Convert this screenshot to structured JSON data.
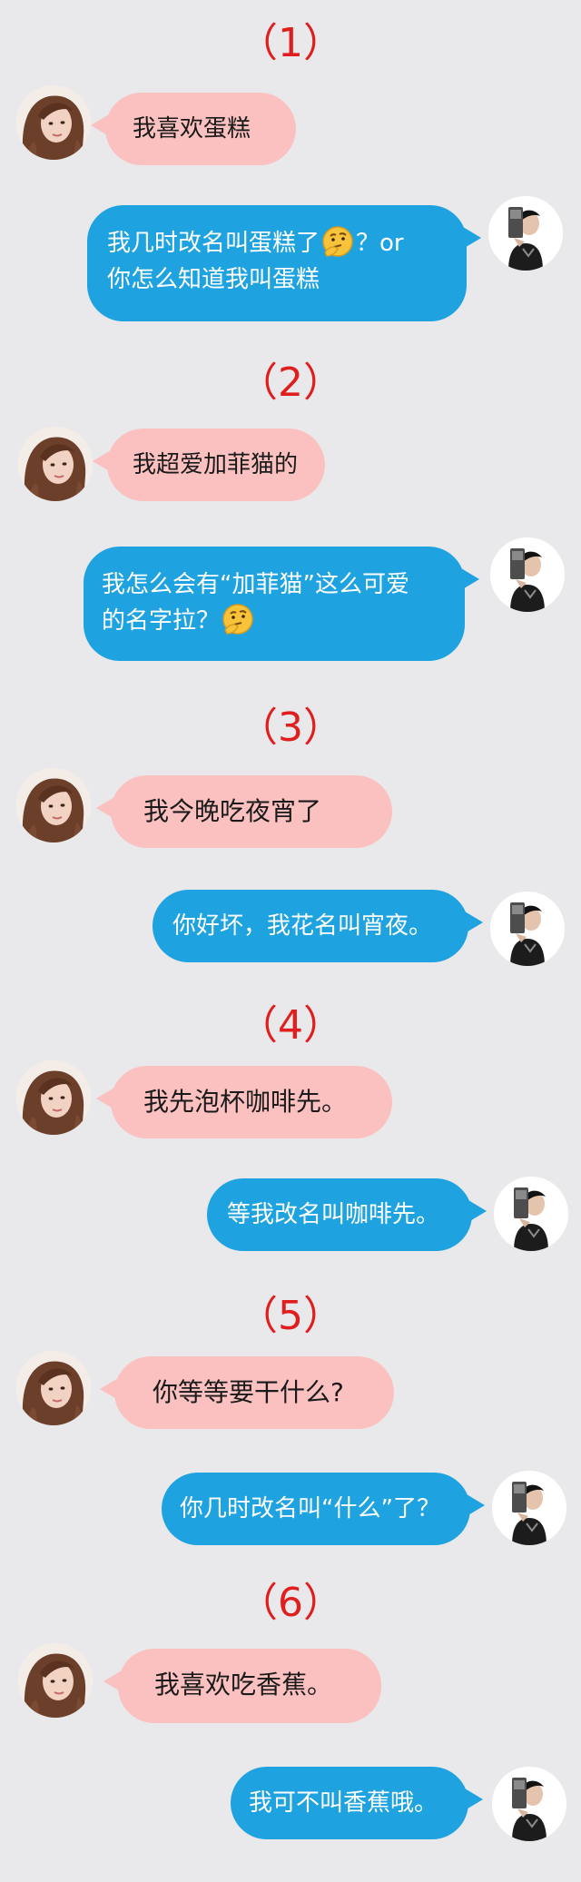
{
  "conversations": [
    {
      "heading": "（1）",
      "left": "我喜欢蛋糕",
      "right_line1": "我几时改名叫蛋糕了",
      "right_line1_suffix": "？or",
      "right_line2": "你怎么知道我叫蛋糕",
      "emoji": "thinking-face"
    },
    {
      "heading": "（2）",
      "left": "我超爱加菲猫的",
      "right_line1": "我怎么会有“加菲猫”这么可爱",
      "right_line2": "的名字拉？",
      "emoji": "thinking-face"
    },
    {
      "heading": "（3）",
      "left": "我今晚吃夜宵了",
      "right": "你好坏，我花名叫宵夜。"
    },
    {
      "heading": "（4）",
      "left": "我先泡杯咖啡先。",
      "right": "等我改名叫咖啡先。"
    },
    {
      "heading": "（5）",
      "left": "你等等要干什么?",
      "right": "你几时改名叫“什么”了？"
    },
    {
      "heading": "（6）",
      "left": "我喜欢吃香蕉。",
      "right": "我可不叫香蕉哦。"
    }
  ],
  "colors": {
    "background": "#e9e9ec",
    "heading": "#e01e1e",
    "left_bubble": "#fbc1c0",
    "right_bubble": "#1ea2e0"
  },
  "icons": {
    "left_avatar": "girl-avatar",
    "right_avatar": "boy-avatar",
    "emoji": "thinking-face-emoji"
  }
}
